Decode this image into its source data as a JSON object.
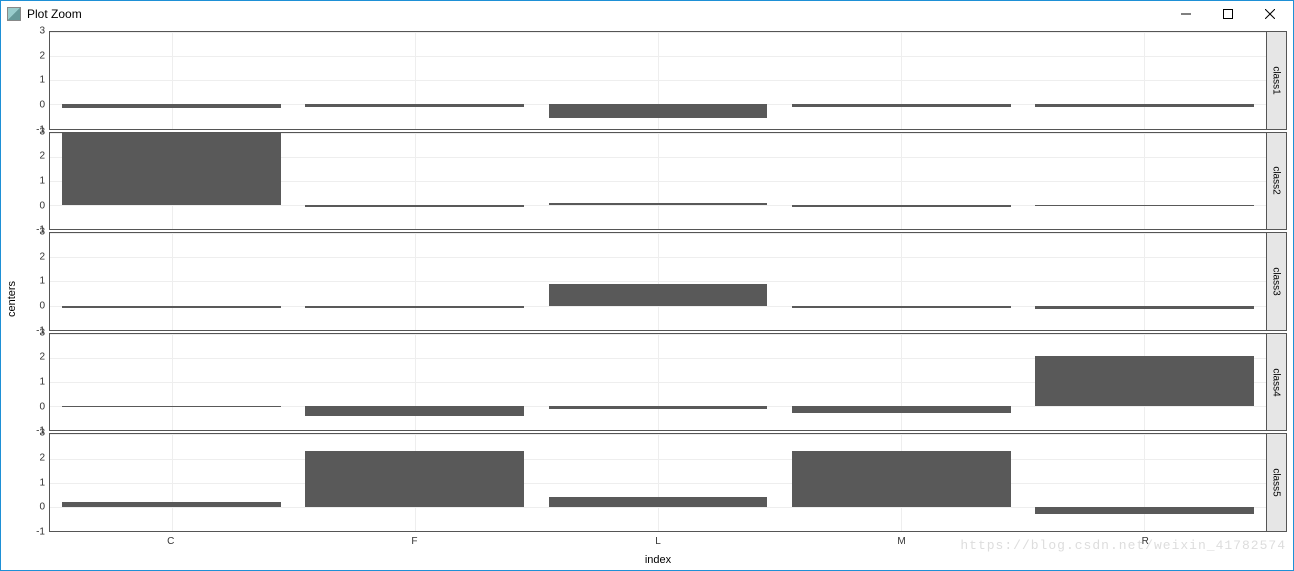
{
  "window": {
    "title": "Plot Zoom"
  },
  "axes": {
    "xlabel": "index",
    "ylabel": "centers"
  },
  "chart_data": {
    "type": "bar",
    "facets": [
      "class1",
      "class2",
      "class3",
      "class4",
      "class5"
    ],
    "categories": [
      "C",
      "F",
      "L",
      "M",
      "R"
    ],
    "ylim": [
      -1,
      3
    ],
    "yticks": [
      -1,
      0,
      1,
      2,
      3
    ],
    "series": [
      {
        "name": "class1",
        "values": [
          -0.15,
          -0.1,
          -0.58,
          -0.1,
          -0.1
        ]
      },
      {
        "name": "class2",
        "values": [
          3.0,
          -0.1,
          0.1,
          -0.1,
          -0.02
        ]
      },
      {
        "name": "class3",
        "values": [
          -0.1,
          -0.1,
          0.9,
          -0.1,
          -0.12
        ]
      },
      {
        "name": "class4",
        "values": [
          0.0,
          -0.4,
          -0.1,
          -0.3,
          2.1
        ]
      },
      {
        "name": "class5",
        "values": [
          0.2,
          2.3,
          0.4,
          2.3,
          -0.3
        ]
      }
    ]
  },
  "watermark": "https://blog.csdn.net/weixin_41782574"
}
